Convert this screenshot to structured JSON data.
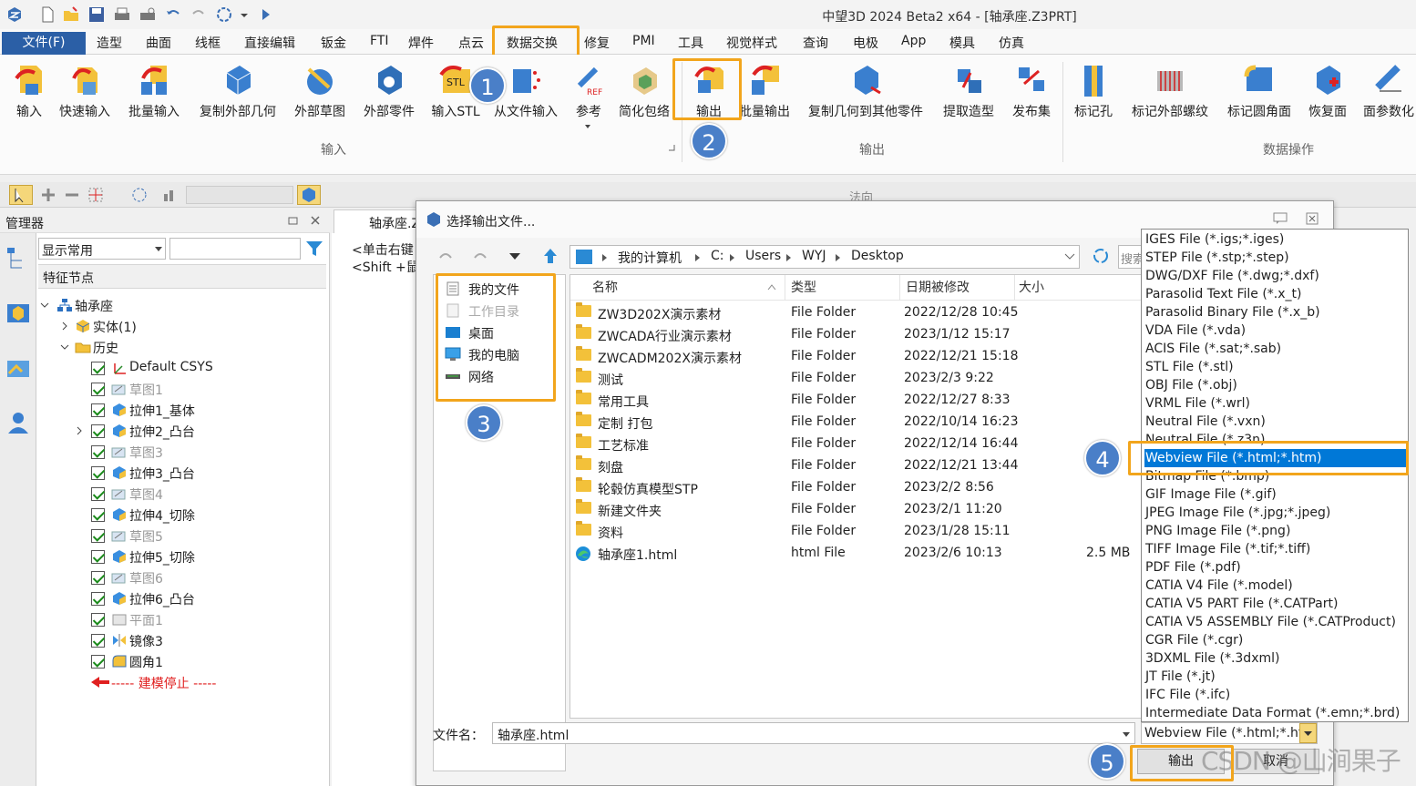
{
  "window": {
    "title": "中望3D 2024 Beta2 x64 - [轴承座.Z3PRT]"
  },
  "menu": {
    "file": "文件(F)",
    "items": [
      "造型",
      "曲面",
      "线框",
      "直接编辑",
      "钣金",
      "FTI",
      "焊件",
      "点云",
      "数据交换",
      "修复",
      "PMI",
      "工具",
      "视觉样式",
      "查询",
      "电极",
      "App",
      "模具",
      "仿真"
    ]
  },
  "ribbon": {
    "buttons": [
      "输入",
      "快速输入",
      "批量输入",
      "复制外部几何",
      "外部草图",
      "外部零件",
      "输入STL",
      "从文件输入",
      "参考",
      "简化包络",
      "输出",
      "批量输出",
      "复制几何到其他零件",
      "提取造型",
      "发布集",
      "标记孔",
      "标记外部螺纹",
      "标记圆角面",
      "恢复面",
      "面参数化"
    ],
    "groups": [
      "输入",
      "输出",
      "数据操作"
    ]
  },
  "badges": [
    "1",
    "2",
    "3",
    "4",
    "5"
  ],
  "toolbar": {
    "direction_label": "法向"
  },
  "manager": {
    "title": "管理器",
    "filter": "显示常用",
    "header": "特征节点",
    "tree": [
      {
        "label": "轴承座"
      },
      {
        "label": "实体(1)"
      },
      {
        "label": "历史"
      },
      {
        "label": "Default CSYS"
      },
      {
        "label": "草图1"
      },
      {
        "label": "拉伸1_基体"
      },
      {
        "label": "拉伸2_凸台"
      },
      {
        "label": "草图3"
      },
      {
        "label": "拉伸3_凸台"
      },
      {
        "label": "草图4"
      },
      {
        "label": "拉伸4_切除"
      },
      {
        "label": "草图5"
      },
      {
        "label": "拉伸5_切除"
      },
      {
        "label": "草图6"
      },
      {
        "label": "拉伸6_凸台"
      },
      {
        "label": "平面1"
      },
      {
        "label": "镜像3"
      },
      {
        "label": "圆角1"
      },
      {
        "label": "----- 建模停止 -----"
      }
    ]
  },
  "doc_tab": {
    "label": "轴承座.Z",
    "hint1": "<单击右键",
    "hint2": "<Shift +鼠"
  },
  "dialog": {
    "title": "选择输出文件...",
    "breadcrumb": [
      "我的计算机",
      "C:",
      "Users",
      "WYJ",
      "Desktop"
    ],
    "search_placeholder": "搜索",
    "nav": [
      "我的文件",
      "工作目录",
      "桌面",
      "我的电脑",
      "网络"
    ],
    "columns": [
      "名称",
      "类型",
      "日期被修改",
      "大小"
    ],
    "files": [
      {
        "name": "ZW3D202X演示素材",
        "type": "File Folder",
        "date": "2022/12/28 10:45",
        "size": ""
      },
      {
        "name": "ZWCADA行业演示素材",
        "type": "File Folder",
        "date": "2023/1/12 15:17",
        "size": ""
      },
      {
        "name": "ZWCADM202X演示素材",
        "type": "File Folder",
        "date": "2022/12/21 15:18",
        "size": ""
      },
      {
        "name": "测试",
        "type": "File Folder",
        "date": "2023/2/3 9:22",
        "size": ""
      },
      {
        "name": "常用工具",
        "type": "File Folder",
        "date": "2022/12/27 8:33",
        "size": ""
      },
      {
        "name": "定制 打包",
        "type": "File Folder",
        "date": "2022/10/14 16:23",
        "size": ""
      },
      {
        "name": "工艺标准",
        "type": "File Folder",
        "date": "2022/12/14 16:44",
        "size": ""
      },
      {
        "name": "刻盘",
        "type": "File Folder",
        "date": "2022/12/21 13:44",
        "size": ""
      },
      {
        "name": "轮毂仿真模型STP",
        "type": "File Folder",
        "date": "2023/2/2 8:56",
        "size": ""
      },
      {
        "name": "新建文件夹",
        "type": "File Folder",
        "date": "2023/2/1 11:20",
        "size": ""
      },
      {
        "name": "资料",
        "type": "File Folder",
        "date": "2023/1/28 15:11",
        "size": ""
      },
      {
        "name": "轴承座1.html",
        "type": "html File",
        "date": "2023/2/6 10:13",
        "size": "2.5 MB"
      }
    ],
    "filetypes": [
      "IGES File (*.igs;*.iges)",
      "STEP File (*.stp;*.step)",
      "DWG/DXF File (*.dwg;*.dxf)",
      "Parasolid Text File (*.x_t)",
      "Parasolid Binary File (*.x_b)",
      "VDA File (*.vda)",
      "ACIS File (*.sat;*.sab)",
      "STL File (*.stl)",
      "OBJ File (*.obj)",
      "VRML File (*.wrl)",
      "Neutral File (*.vxn)",
      "Neutral File (*.z3n)",
      "Webview File (*.html;*.htm)",
      "Bitmap File (*.bmp)",
      "GIF Image File (*.gif)",
      "JPEG Image File (*.jpg;*.jpeg)",
      "PNG Image File (*.png)",
      "TIFF Image File (*.tif;*.tiff)",
      "PDF File (*.pdf)",
      "CATIA V4 File (*.model)",
      "CATIA V5 PART File (*.CATPart)",
      "CATIA V5 ASSEMBLY File (*.CATProduct)",
      "CGR File (*.cgr)",
      "3DXML File (*.3dxml)",
      "JT File (*.jt)",
      "IFC File (*.ifc)",
      "Intermediate Data Format (*.emn;*.brd)"
    ],
    "filename_label": "文件名：",
    "filename_value": "轴承座.html",
    "selected_type": "Webview File (*.html;*.htm",
    "ok": "输出",
    "cancel": "取消"
  },
  "watermark": "CSDN @山涧果子",
  "colors": {
    "accent": "#2b5fa6",
    "highlight": "#f2a51c",
    "badge": "#4a7fc8",
    "selection": "#0078d7"
  }
}
